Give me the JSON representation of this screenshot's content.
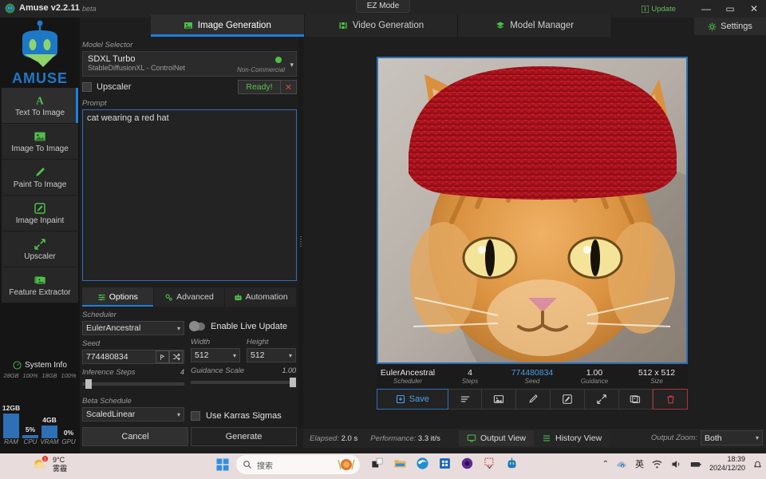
{
  "window": {
    "title": "Amuse v2.2.11",
    "beta": "beta",
    "update_label": "Update",
    "minimize": "—",
    "maximize": "▭",
    "close": "✕",
    "settings_label": "Settings",
    "ez_mode": "EZ Mode"
  },
  "tabs": [
    {
      "label": "Image Generation",
      "icon": "image-icon",
      "active": true
    },
    {
      "label": "Video Generation",
      "icon": "film-icon",
      "active": false
    },
    {
      "label": "Model Manager",
      "icon": "layers-icon",
      "active": false
    }
  ],
  "sidebar": {
    "logo_text": "AMUSE",
    "items": [
      {
        "label": "Text To Image",
        "icon": "letter-a-icon",
        "active": true
      },
      {
        "label": "Image To Image",
        "icon": "image-icon",
        "active": false
      },
      {
        "label": "Paint To Image",
        "icon": "brush-icon",
        "active": false
      },
      {
        "label": "Image Inpaint",
        "icon": "pencil-square-icon",
        "active": false
      },
      {
        "label": "Upscaler",
        "icon": "expand-arrows-icon",
        "active": false
      },
      {
        "label": "Feature Extractor",
        "icon": "stacked-images-icon",
        "active": false
      }
    ]
  },
  "system_info": {
    "title": "System Info",
    "metrics": [
      {
        "name": "RAM",
        "total": "28GB",
        "value": "12GB",
        "percent": 43
      },
      {
        "name": "CPU",
        "total": "100%",
        "value": "5%",
        "percent": 5
      },
      {
        "name": "VRAM",
        "total": "18GB",
        "value": "4GB",
        "percent": 22
      },
      {
        "name": "GPU",
        "total": "100%",
        "value": "0%",
        "percent": 0
      }
    ]
  },
  "config": {
    "model_selector_label": "Model Selector",
    "model_name": "SDXL Turbo",
    "model_sub": "StableDiffusionXL - ControlNet",
    "model_license": "Non-Commercial",
    "upscaler_label": "Upscaler",
    "ready_label": "Ready!",
    "close_label": "✕",
    "prompt_label": "Prompt",
    "prompt_value": "cat wearing a red hat",
    "prompt_placeholder": "Prompt",
    "option_tabs": [
      {
        "label": "Options",
        "icon": "sliders-icon",
        "active": true
      },
      {
        "label": "Advanced",
        "icon": "gears-icon",
        "active": false
      },
      {
        "label": "Automation",
        "icon": "robot-icon",
        "active": false
      }
    ],
    "scheduler_label": "Scheduler",
    "scheduler_value": "EulerAncestral",
    "live_update_label": "Enable Live Update",
    "live_update_on": false,
    "seed_label": "Seed",
    "seed_value": "774480834",
    "width_label": "Width",
    "width_value": "512",
    "height_label": "Height",
    "height_value": "512",
    "inference_steps_label": "Inference Steps",
    "inference_steps_value": "4",
    "inference_steps_percent": 3,
    "guidance_label": "Guidance Scale",
    "guidance_value": "1.00",
    "guidance_percent": 97,
    "beta_schedule_label": "Beta Schedule",
    "beta_schedule_value": "ScaledLinear",
    "karras_label": "Use Karras Sigmas",
    "karras_on": false,
    "cancel_label": "Cancel",
    "generate_label": "Generate"
  },
  "output": {
    "image_alt": "orange tabby cat wearing a red knit hat",
    "meta": [
      {
        "value": "EulerAncestral",
        "label": "Scheduler"
      },
      {
        "value": "4",
        "label": "Steps"
      },
      {
        "value": "774480834",
        "label": "Seed"
      },
      {
        "value": "1.00",
        "label": "Guidance"
      },
      {
        "value": "512 x 512",
        "label": "Size"
      }
    ],
    "toolbar": [
      {
        "name": "save-button",
        "label": "Save",
        "icon": "save-icon"
      },
      {
        "name": "details-button",
        "label": "",
        "icon": "list-icon"
      },
      {
        "name": "image-to-image-button",
        "label": "",
        "icon": "image-icon"
      },
      {
        "name": "paint-button",
        "label": "",
        "icon": "brush-icon"
      },
      {
        "name": "inpaint-button",
        "label": "",
        "icon": "pencil-square-icon"
      },
      {
        "name": "upscale-button",
        "label": "",
        "icon": "expand-arrows-icon"
      },
      {
        "name": "feature-extract-button",
        "label": "",
        "icon": "stacked-images-icon"
      },
      {
        "name": "delete-button",
        "label": "",
        "icon": "trash-icon"
      }
    ]
  },
  "status": {
    "elapsed_label": "Elapsed:",
    "elapsed_value": "2.0 s",
    "performance_label": "Performance:",
    "performance_value": "3.3 it/s",
    "output_view": "Output View",
    "history_view": "History View",
    "zoom_label": "Output Zoom:",
    "zoom_value": "Both"
  },
  "taskbar": {
    "weather_temp": "9°C",
    "weather_desc": "雾霾",
    "weather_badge": "1",
    "search_placeholder": "搜索",
    "ime": "英",
    "time": "18:39",
    "date": "2024/12/20"
  },
  "colors": {
    "accent_blue": "#1c7fe0",
    "green": "#4fbf4a",
    "red": "#c0392b",
    "seed_blue": "#4b9fe8"
  }
}
